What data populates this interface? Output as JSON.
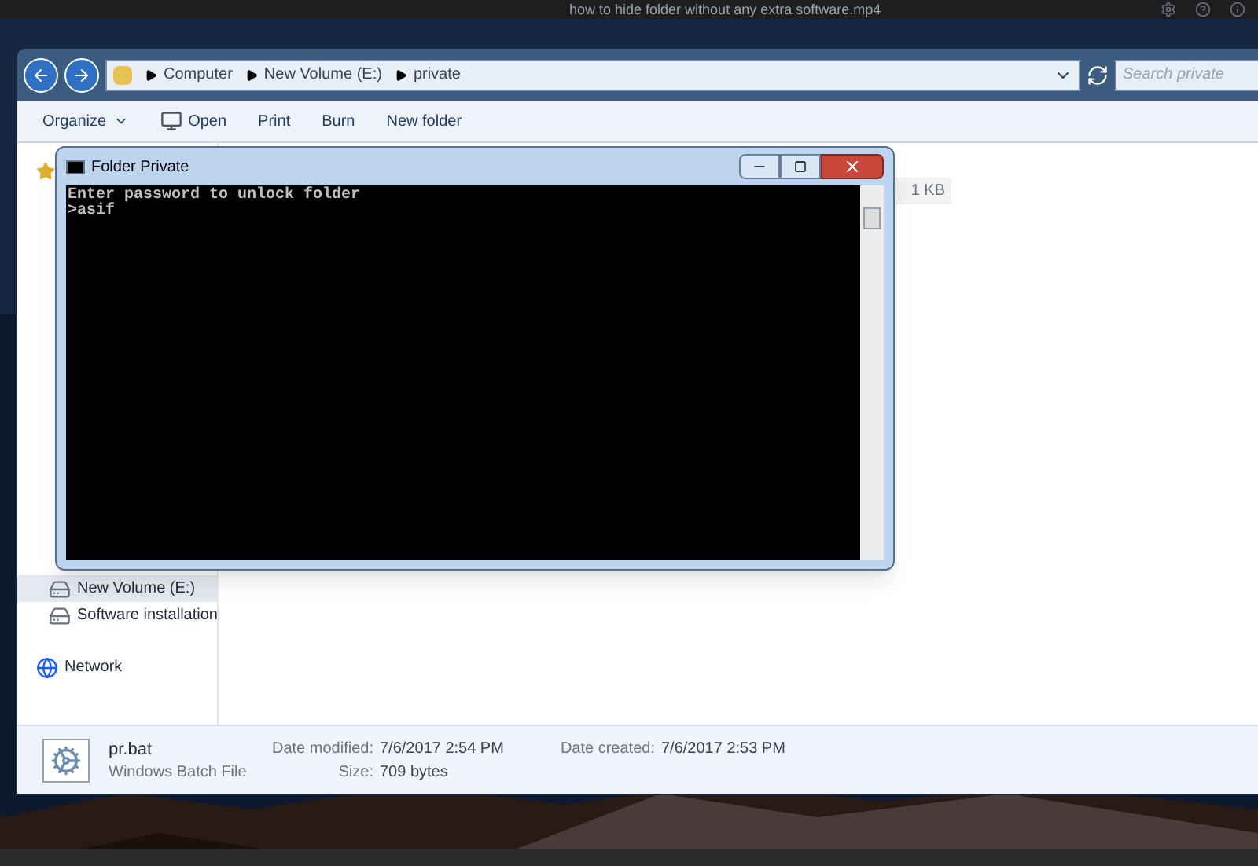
{
  "player_title": "how to hide folder without any extra software.mp4",
  "explorer": {
    "breadcrumb": [
      "Computer",
      "New Volume (E:)",
      "private"
    ],
    "search": {
      "placeholder": "Search private"
    },
    "toolbar": [
      {
        "label": "Organize",
        "kind": "menu"
      },
      {
        "label": "Open",
        "kind": "app"
      },
      {
        "label": "Print",
        "kind": "plain"
      },
      {
        "label": "Burn",
        "kind": "plain"
      },
      {
        "label": "New folder",
        "kind": "plain"
      }
    ],
    "nav": [
      {
        "label": "New Volume (E:)",
        "kind": "drive",
        "selected": true
      },
      {
        "label": "Software installation",
        "kind": "drive",
        "selected": false
      },
      {
        "label": "Network",
        "kind": "network",
        "selected": false
      }
    ],
    "file_row": {
      "size": "1 KB"
    },
    "details": {
      "name": "pr.bat",
      "type": "Windows Batch File",
      "fields": [
        {
          "label": "Date modified:",
          "value": "7/6/2017 2:54 PM"
        },
        {
          "label": "Size:",
          "value": "709 bytes"
        },
        {
          "label": "Date created:",
          "value": "7/6/2017 2:53 PM"
        }
      ]
    }
  },
  "console": {
    "title": "Folder Private",
    "lines": [
      "Enter password to unlock folder",
      ">asif"
    ]
  }
}
